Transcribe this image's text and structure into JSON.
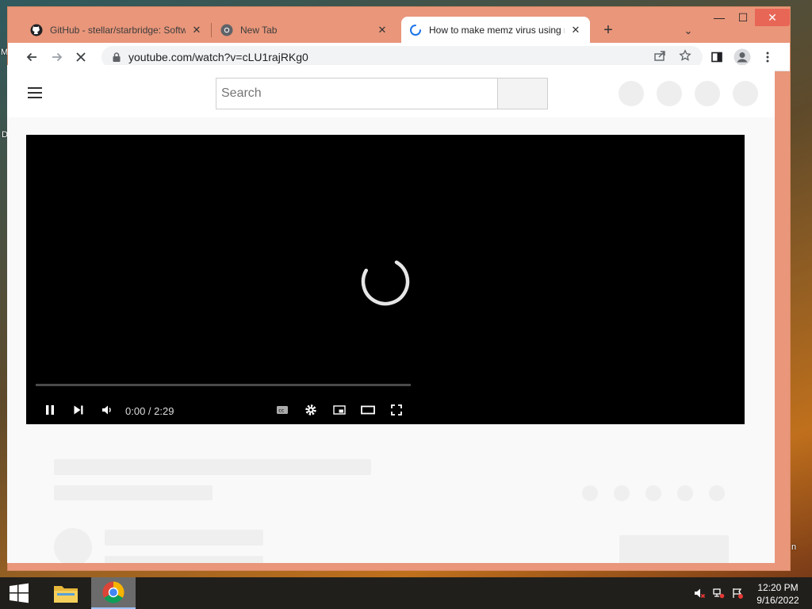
{
  "desktop": {
    "left_label_1": "M",
    "left_label_2": "D",
    "right_label": "n"
  },
  "browser": {
    "tabs": [
      {
        "title": "GitHub - stellar/starbridge: Softw",
        "close": "✕",
        "active": false
      },
      {
        "title": "New Tab",
        "close": "✕",
        "active": false
      },
      {
        "title": "How to make memz virus using n",
        "close": "✕",
        "active": true
      }
    ],
    "new_tab_glyph": "+",
    "tab_list_glyph": "⌄",
    "window_controls": {
      "minimize": "—",
      "maximize": "☐",
      "close": "✕"
    },
    "address": "youtube.com/watch?v=cLU1rajRKg0"
  },
  "youtube": {
    "search_placeholder": "Search",
    "player": {
      "time": "0:00 / 2:29",
      "progress": 0.0
    }
  },
  "taskbar": {
    "time": "12:20 PM",
    "date": "9/16/2022"
  },
  "colors": {
    "window_frame": "#e9967a",
    "close_button": "#e86656",
    "spinner_blue": "#1a73e8"
  }
}
